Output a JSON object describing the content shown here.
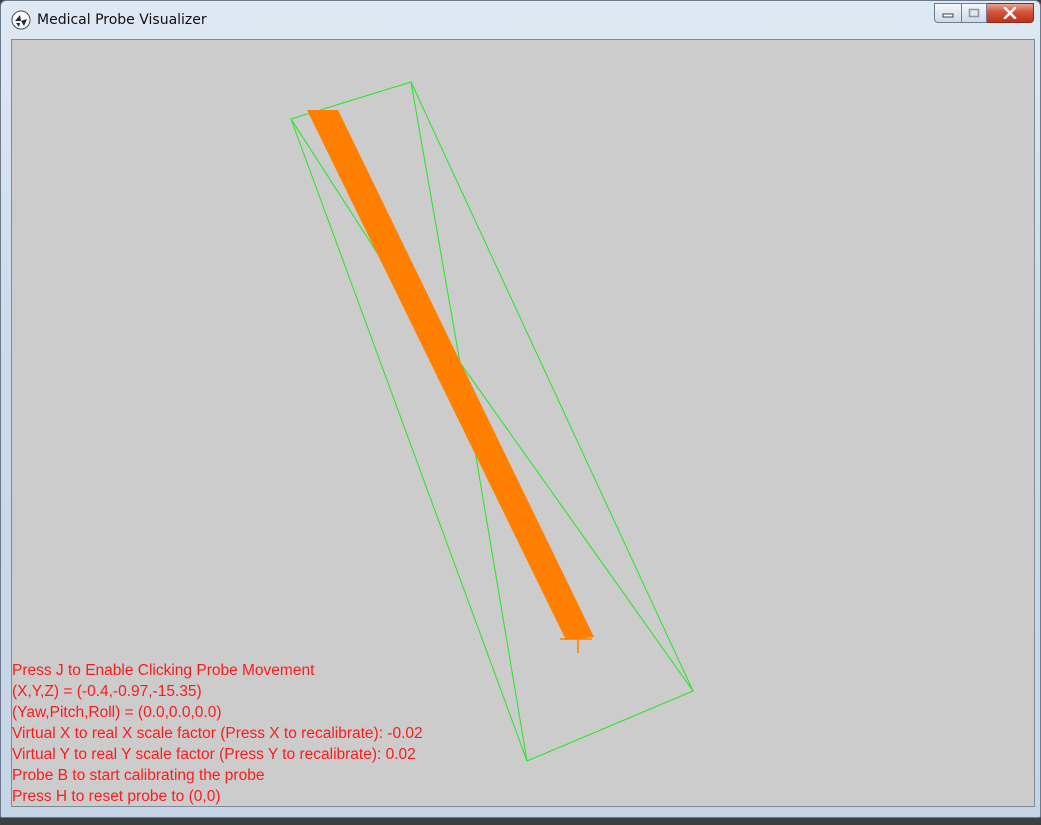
{
  "window": {
    "title": "Medical Probe Visualizer",
    "icon": "app-logo-icon",
    "buttons": [
      "minimize-icon",
      "maximize-icon",
      "close-icon"
    ]
  },
  "scene": {
    "background": "#cccccd",
    "frame_color": "#22e622",
    "probe_color": "#ff8000"
  },
  "hud": {
    "color": "#ff1a1a",
    "lines": [
      "Press J to Enable Clicking Probe Movement",
      "(X,Y,Z) = (-0.4,-0.97,-15.35)",
      "(Yaw,Pitch,Roll) = (0.0,0.0,0.0)",
      "Virtual X to real X scale factor (Press X to recalibrate): -0.02",
      "Virtual Y to real Y scale factor (Press Y to recalibrate): 0.02",
      "Probe B to start calibrating the probe",
      "Press H to reset probe to (0,0)"
    ]
  }
}
